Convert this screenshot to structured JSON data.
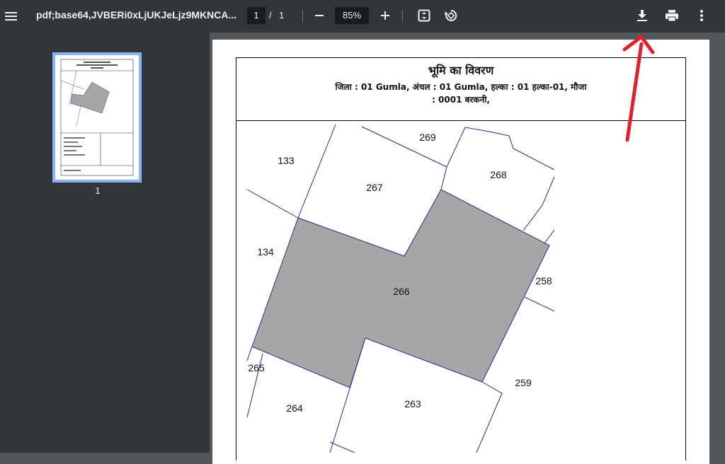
{
  "toolbar": {
    "title": "pdf;base64,JVBERi0xLjUKJeLjz9MKNCA...",
    "page_current": "1",
    "page_separator": "/",
    "page_total": "1",
    "zoom": "85%"
  },
  "sidebar": {
    "thumbnail_page_number": "1"
  },
  "document": {
    "title": "भूमि का विवरण",
    "subtitle_line1": "जिला : 01 Gumla, अंचल : 01 Gumla, हल्का : 01 हल्का-01, मौजा",
    "subtitle_line2": ": 0001 बरकनी,",
    "plots": {
      "p133": "133",
      "p134": "134",
      "p267": "267",
      "p269": "269",
      "p268": "268",
      "p266": "266",
      "p258": "258",
      "p265": "265",
      "p264": "264",
      "p263": "263",
      "p259": "259"
    }
  },
  "colors": {
    "toolbar_bg": "#323639",
    "highlighted_plot": "#a6a6a6",
    "boundary_line": "#2b2b8a",
    "annotation_arrow": "#e0202f",
    "thumbnail_border": "#8ab4f8"
  }
}
